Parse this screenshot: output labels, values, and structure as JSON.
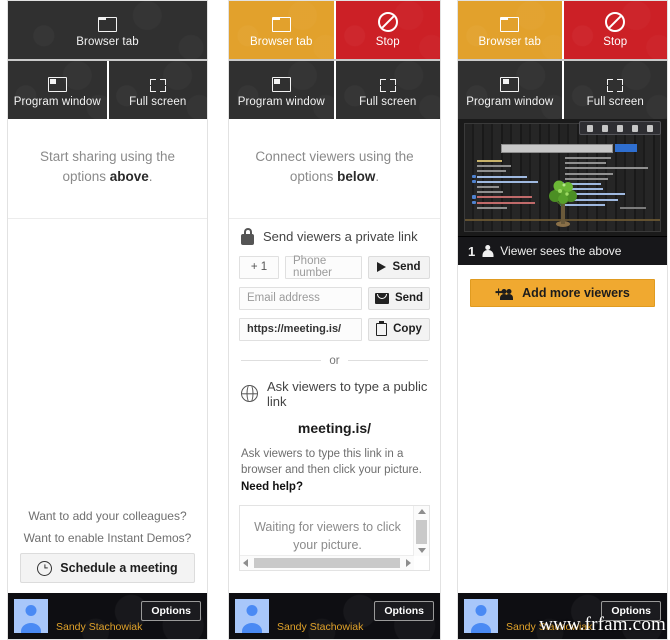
{
  "panels": [
    {
      "id": "panel-start",
      "tiles": {
        "browser_tab": {
          "label": "Browser tab",
          "icon": "browser-tab-icon",
          "state": "inactive"
        },
        "stop": {
          "label": "Stop",
          "icon": "stop-icon",
          "visible": false
        },
        "program_window": {
          "label": "Program window",
          "icon": "program-window-icon"
        },
        "full_screen": {
          "label": "Full screen",
          "icon": "fullscreen-icon"
        }
      },
      "message": {
        "text": "Start sharing using the options ",
        "emphasis": "above",
        "suffix": "."
      },
      "prompts": [
        "Want to add your colleagues?",
        "Want to enable Instant Demos?"
      ],
      "schedule_button": {
        "label": "Schedule a meeting",
        "icon": "clock-icon"
      },
      "user": {
        "name": "Sandy Stachowiak",
        "options_label": "Options",
        "avatar": "user-avatar"
      }
    },
    {
      "id": "panel-connect",
      "tiles": {
        "browser_tab": {
          "label": "Browser tab",
          "icon": "browser-tab-icon",
          "state": "active",
          "color": "#e2a12c"
        },
        "stop": {
          "label": "Stop",
          "icon": "stop-icon",
          "visible": true,
          "color": "#cc2026"
        },
        "program_window": {
          "label": "Program window",
          "icon": "program-window-icon"
        },
        "full_screen": {
          "label": "Full screen",
          "icon": "fullscreen-icon"
        }
      },
      "message": {
        "text": "Connect viewers using the options ",
        "emphasis": "below",
        "suffix": "."
      },
      "private_link": {
        "heading": "Send viewers a private link",
        "icon": "lock-icon",
        "phone": {
          "country_code": "+ 1",
          "placeholder": "Phone number",
          "send_label": "Send",
          "send_icon": "send-icon"
        },
        "email": {
          "placeholder": "Email address",
          "send_label": "Send",
          "send_icon": "mail-icon"
        },
        "link": {
          "value": "https://meeting.is/",
          "copy_label": "Copy",
          "copy_icon": "copy-icon"
        }
      },
      "divider_label": "or",
      "public_link": {
        "heading": "Ask viewers to type a public link",
        "icon": "globe-icon",
        "url": "meeting.is/",
        "hint": "Ask viewers to type this link in a browser and then click your picture.",
        "hint_link": "Need help?",
        "status": "Waiting for viewers to click your picture."
      },
      "user": {
        "name": "Sandy Stachowiak",
        "options_label": "Options",
        "avatar": "user-avatar"
      }
    },
    {
      "id": "panel-sharing",
      "tiles": {
        "browser_tab": {
          "label": "Browser tab",
          "icon": "browser-tab-icon",
          "state": "active",
          "color": "#e2a12c"
        },
        "stop": {
          "label": "Stop",
          "icon": "stop-icon",
          "visible": true,
          "color": "#cc2026"
        },
        "program_window": {
          "label": "Program window",
          "icon": "program-window-icon"
        },
        "full_screen": {
          "label": "Full screen",
          "icon": "fullscreen-icon"
        }
      },
      "viewer_bar": {
        "count": "1",
        "icon": "person-icon",
        "label": "Viewer sees the above"
      },
      "add_viewers_button": {
        "label": "Add more viewers",
        "icon": "add-people-icon",
        "color": "#f0a930"
      },
      "user": {
        "name": "Sandy Stachowiak",
        "options_label": "Options",
        "avatar": "user-avatar"
      }
    }
  ],
  "watermark": "www.frfam.com"
}
